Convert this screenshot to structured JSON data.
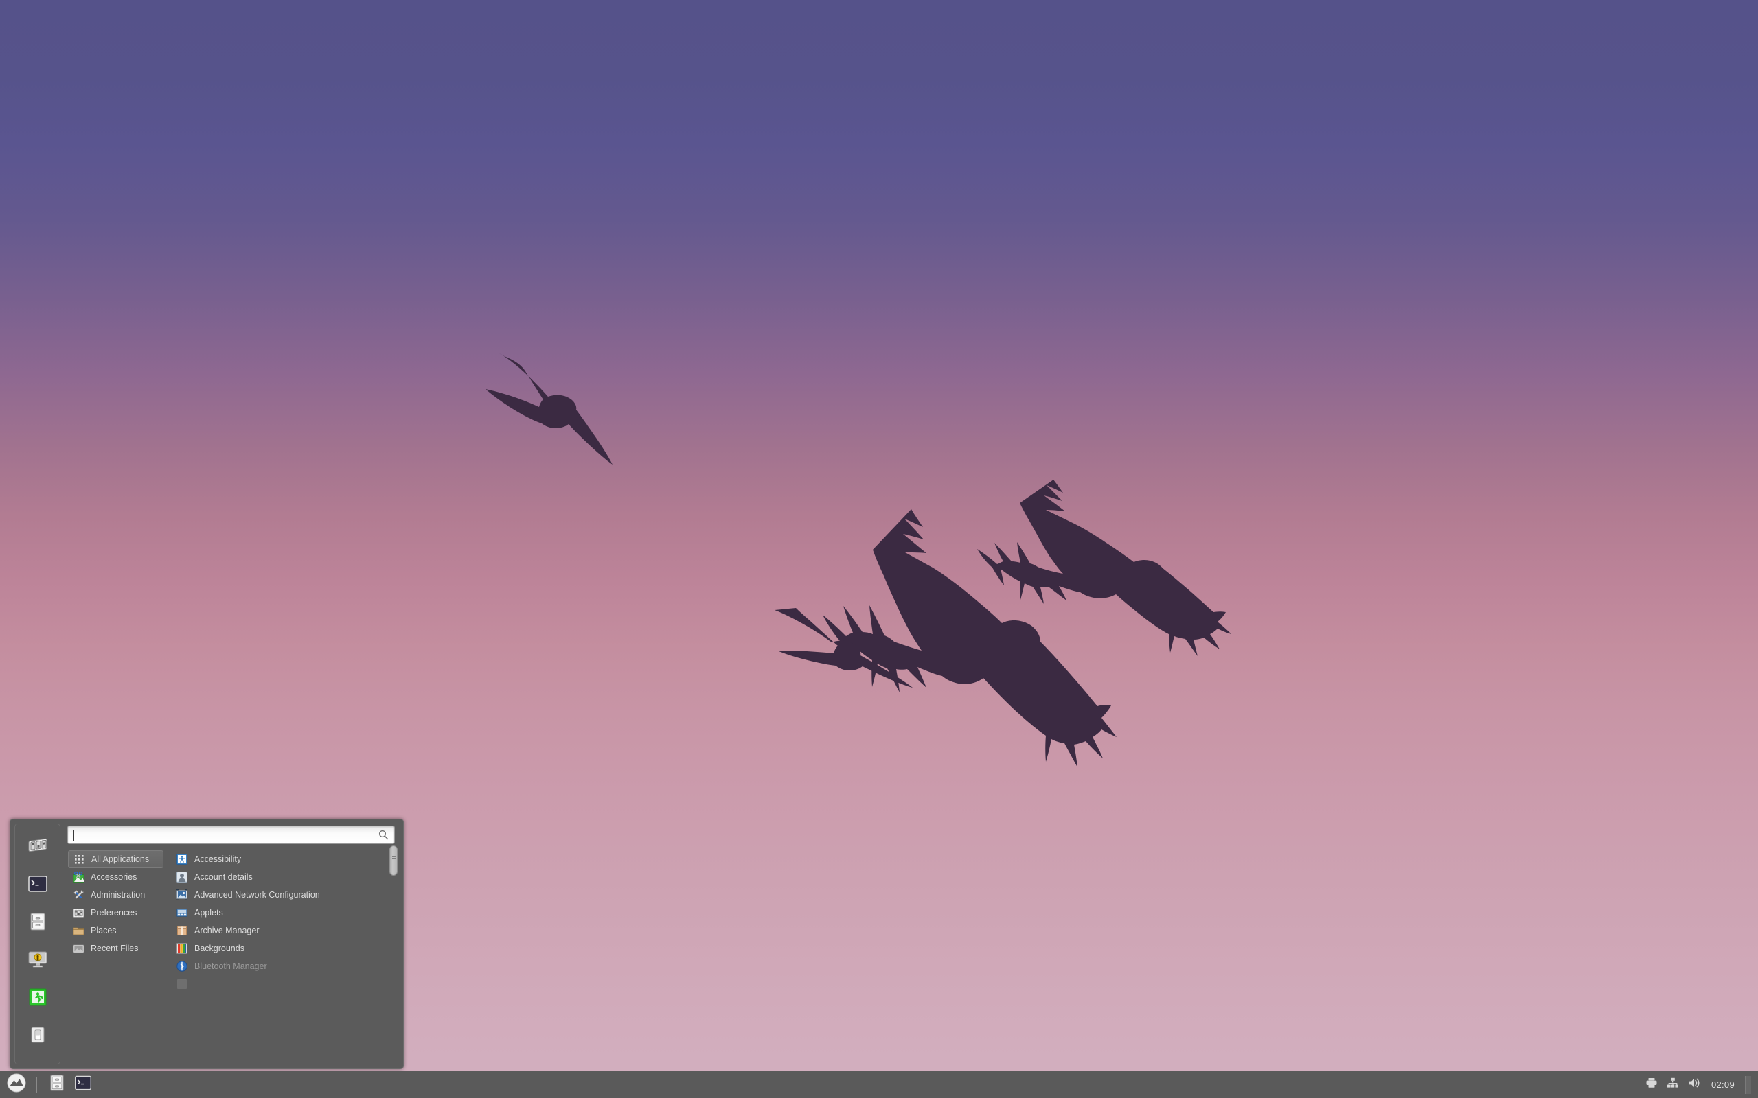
{
  "desktop": {
    "wallpaper_name": "birds-sunset-sky",
    "wallpaper_top_color": "#55528a",
    "wallpaper_bottom_color": "#d3b0c0",
    "bird_silhouette_color": "#3a2840"
  },
  "menu": {
    "search": {
      "value": "",
      "placeholder": "",
      "icon": "search-icon"
    },
    "sidebar": [
      {
        "name": "preferences-shortcut",
        "icon": "preferences-icon",
        "tooltip": "Preferences"
      },
      {
        "name": "terminal-shortcut",
        "icon": "terminal-icon",
        "tooltip": "Terminal"
      },
      {
        "name": "files-shortcut",
        "icon": "file-cabinet-icon",
        "tooltip": "Files"
      },
      {
        "name": "lock-screen-shortcut",
        "icon": "lock-screen-icon",
        "tooltip": "Lock Screen"
      },
      {
        "name": "logout-shortcut",
        "icon": "logout-icon",
        "tooltip": "Log Out"
      },
      {
        "name": "quit-shortcut",
        "icon": "power-switch-icon",
        "tooltip": "Quit"
      }
    ],
    "categories": [
      {
        "label": "All Applications",
        "icon": "grid-icon",
        "selected": true
      },
      {
        "label": "Accessories",
        "icon": "accessories-icon",
        "selected": false
      },
      {
        "label": "Administration",
        "icon": "tools-icon",
        "selected": false
      },
      {
        "label": "Preferences",
        "icon": "preferences-icon",
        "selected": false
      },
      {
        "label": "Places",
        "icon": "folder-icon",
        "selected": false
      },
      {
        "label": "Recent Files",
        "icon": "recent-files-icon",
        "selected": false
      }
    ],
    "applications": [
      {
        "label": "Accessibility",
        "icon": "accessibility-icon",
        "dim": false
      },
      {
        "label": "Account details",
        "icon": "user-icon",
        "dim": false
      },
      {
        "label": "Advanced Network Configuration",
        "icon": "network-config-icon",
        "dim": false
      },
      {
        "label": "Applets",
        "icon": "applets-icon",
        "dim": false
      },
      {
        "label": "Archive Manager",
        "icon": "archive-icon",
        "dim": false
      },
      {
        "label": "Backgrounds",
        "icon": "backgrounds-icon",
        "dim": false
      },
      {
        "label": "Bluetooth Manager",
        "icon": "bluetooth-icon",
        "dim": true
      }
    ]
  },
  "panel": {
    "menu_button": {
      "name": "mint-menu-button",
      "icon": "mint-logo-icon"
    },
    "launchers": [
      {
        "name": "files-launcher",
        "icon": "file-cabinet-icon"
      },
      {
        "name": "terminal-launcher",
        "icon": "terminal-icon"
      }
    ],
    "tray": [
      {
        "name": "printer-tray-icon",
        "icon": "printer-icon"
      },
      {
        "name": "network-tray-icon",
        "icon": "network-icon"
      },
      {
        "name": "volume-tray-icon",
        "icon": "volume-icon"
      }
    ],
    "clock": "02:09"
  }
}
